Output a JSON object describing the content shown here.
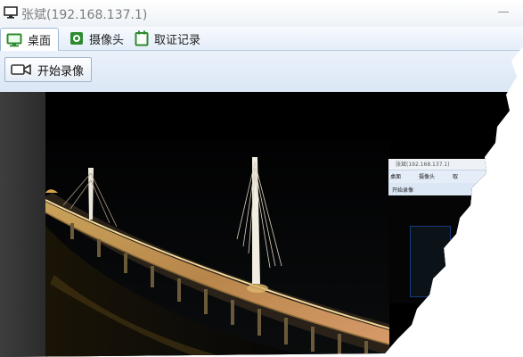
{
  "window": {
    "title": "张斌(192.168.137.1)",
    "minimize_label": "—"
  },
  "tabs": [
    {
      "label": "桌面",
      "icon": "monitor-icon",
      "active": true
    },
    {
      "label": "摄像头",
      "icon": "camera-icon",
      "active": false
    },
    {
      "label": "取证记录",
      "icon": "calendar-icon",
      "active": false
    }
  ],
  "toolbar": {
    "record_label": "开始录像",
    "record_icon": "video-camera-icon"
  },
  "viewport": {
    "scene": "night-view-bridge",
    "inset": {
      "title": "张斌(192.168.137.1)",
      "tabs": [
        "桌面",
        "摄像头",
        "取"
      ],
      "toolbar_label": "开始录像"
    }
  },
  "colors": {
    "title_text": "#7d7d7d",
    "toolbar_bg": "#dbe7f5",
    "tab_icon_green": "#2e8a2e",
    "viewport_bg": "#000000"
  }
}
